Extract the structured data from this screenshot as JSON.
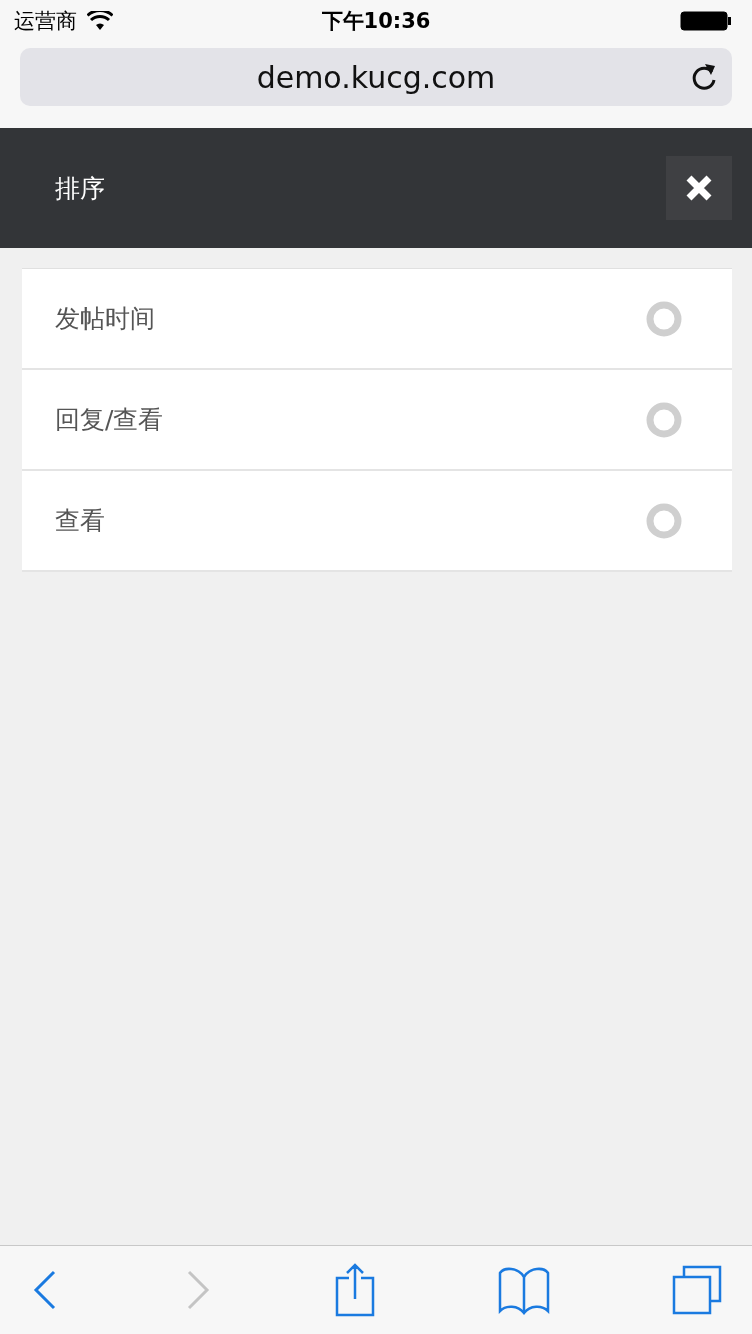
{
  "status_bar": {
    "carrier": "运营商",
    "time": "下午10:36"
  },
  "address_bar": {
    "url": "demo.kucg.com"
  },
  "header": {
    "title": "排序"
  },
  "options": [
    {
      "label": "发帖时间",
      "selected": false
    },
    {
      "label": "回复/查看",
      "selected": false
    },
    {
      "label": "查看",
      "selected": false
    }
  ],
  "toolbar": [
    {
      "kind": "back",
      "disabled": false
    },
    {
      "kind": "forward",
      "disabled": true
    },
    {
      "kind": "share",
      "disabled": false
    },
    {
      "kind": "bookmarks",
      "disabled": false
    },
    {
      "kind": "tabs",
      "disabled": false
    }
  ]
}
